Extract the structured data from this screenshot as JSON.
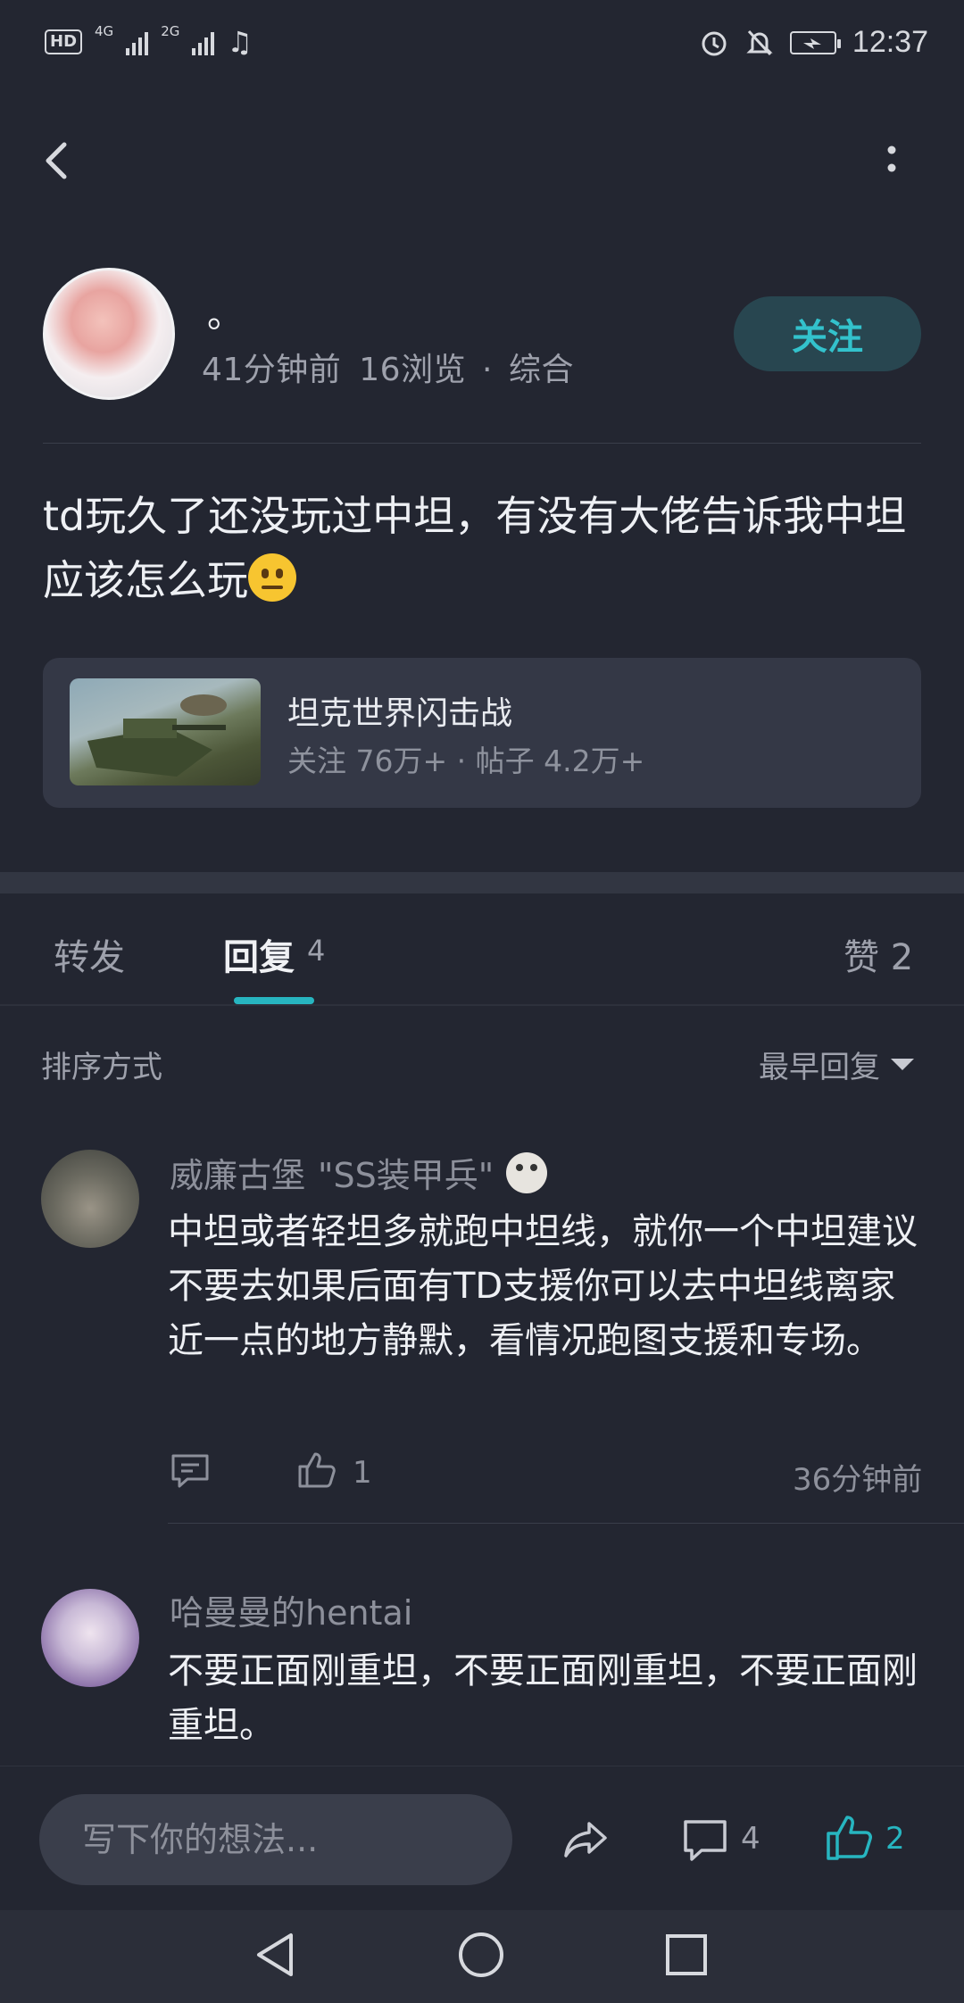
{
  "status_bar": {
    "hd_label": "HD",
    "network_1": "4G",
    "network_2": "2G",
    "time": "12:37"
  },
  "author": {
    "name": "。",
    "time_ago": "41分钟前",
    "views": "16浏览",
    "category": "综合",
    "separator": "·",
    "follow_label": "关注"
  },
  "post": {
    "text": "td玩久了还没玩过中坦，有没有大佬告诉我中坦应该怎么玩"
  },
  "forum": {
    "name": "坦克世界闪击战",
    "stats": "关注 76万+ · 帖子 4.2万+"
  },
  "tabs": {
    "repost": "转发",
    "reply": "回复",
    "reply_count": "4",
    "likes": "赞 2"
  },
  "sort": {
    "label": "排序方式",
    "value": "最早回复"
  },
  "comments": [
    {
      "user": "威廉古堡",
      "title": "\"SS装甲兵\"",
      "text": "中坦或者轻坦多就跑中坦线，就你一个中坦建议不要去如果后面有TD支援你可以去中坦线离家近一点的地方静默，看情况跑图支援和专场。",
      "likes": "1",
      "time": "36分钟前"
    },
    {
      "user": "哈曼曼的hentai",
      "text": "不要正面刚重坦，不要正面刚重坦，不要正面刚重坦。"
    }
  ],
  "bottom_bar": {
    "input_placeholder": "写下你的想法...",
    "comment_count": "4",
    "like_count": "2"
  },
  "colors": {
    "accent": "#27b5c0",
    "background": "#232631",
    "card": "#343846"
  }
}
